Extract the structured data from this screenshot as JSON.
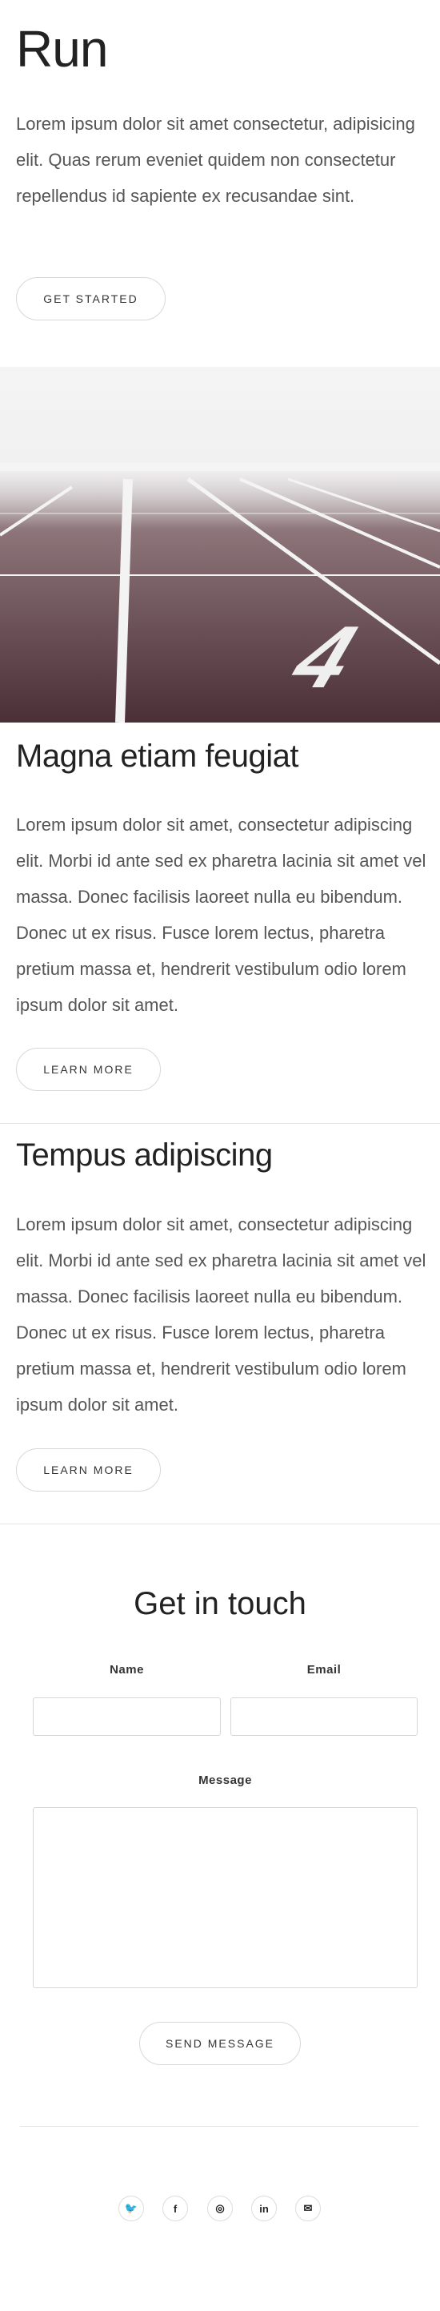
{
  "hero": {
    "title": "Run",
    "text": "Lorem ipsum dolor sit amet consectetur, adipisicing elit. Quas rerum eveniet quidem non consectetur repellendus id sapiente ex recusandae sint.",
    "button_label": "GET STARTED"
  },
  "track_image": {
    "lane_number": "4"
  },
  "sections": [
    {
      "title": "Magna etiam feugiat",
      "text": "Lorem ipsum dolor sit amet, consectetur adipiscing elit. Morbi id ante sed ex pharetra lacinia sit amet vel massa. Donec facilisis laoreet nulla eu bibendum. Donec ut ex risus. Fusce lorem lectus, pharetra pretium massa et, hendrerit vestibulum odio lorem ipsum dolor sit amet.",
      "button_label": "LEARN MORE"
    },
    {
      "title": "Tempus adipiscing",
      "text": "Lorem ipsum dolor sit amet, consectetur adipiscing elit. Morbi id ante sed ex pharetra lacinia sit amet vel massa. Donec facilisis laoreet nulla eu bibendum. Donec ut ex risus. Fusce lorem lectus, pharetra pretium massa et, hendrerit vestibulum odio lorem ipsum dolor sit amet.",
      "button_label": "LEARN MORE"
    }
  ],
  "contact": {
    "title": "Get in touch",
    "name_label": "Name",
    "email_label": "Email",
    "message_label": "Message",
    "name_value": "",
    "email_value": "",
    "message_value": "",
    "submit_label": "SEND MESSAGE"
  },
  "social": [
    {
      "icon": "twitter-icon",
      "glyph": "🐦"
    },
    {
      "icon": "facebook-icon",
      "glyph": "f"
    },
    {
      "icon": "instagram-icon",
      "glyph": "◎"
    },
    {
      "icon": "linkedin-icon",
      "glyph": "in"
    },
    {
      "icon": "email-icon",
      "glyph": "✉"
    }
  ]
}
